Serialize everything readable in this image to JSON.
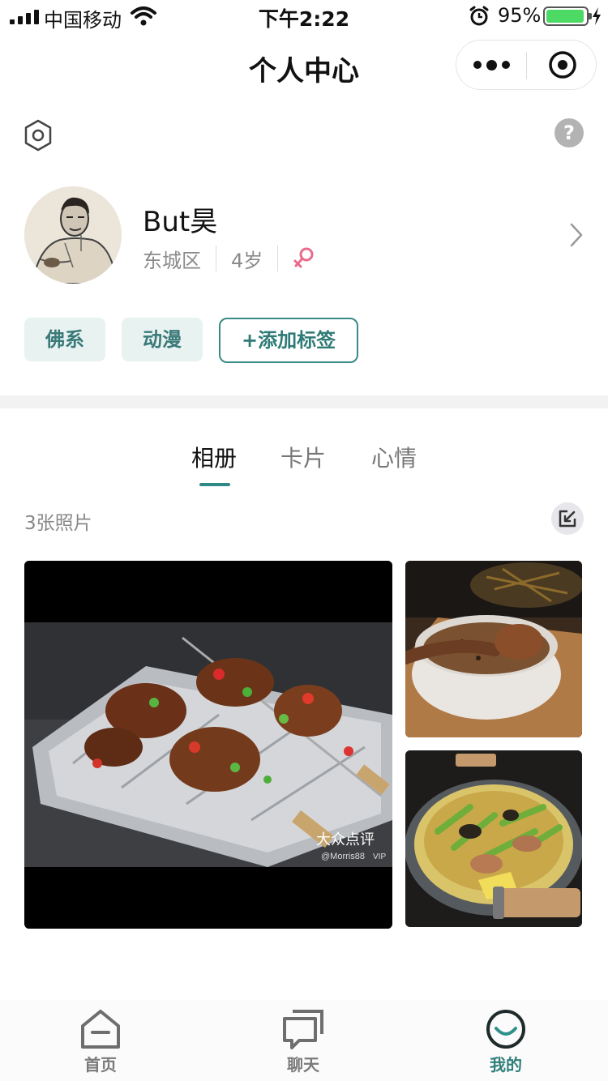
{
  "status_bar": {
    "carrier": "中国移动",
    "time": "下午2:22",
    "battery_percent": "95%",
    "battery_level": 0.95
  },
  "nav": {
    "title": "个人中心"
  },
  "profile": {
    "name": "But昊",
    "district": "东城区",
    "age": "4岁",
    "gender": "female"
  },
  "tags": [
    "佛系",
    "动漫"
  ],
  "add_tag_label": "+添加标签",
  "tabs": [
    {
      "label": "相册",
      "active": true
    },
    {
      "label": "卡片",
      "active": false
    },
    {
      "label": "心情",
      "active": false
    }
  ],
  "album": {
    "count_label": "3张照片",
    "watermark": "大众点评",
    "watermark_user": "@Morris88",
    "watermark_badge": "VIP"
  },
  "tab_bar": [
    {
      "label": "首页",
      "icon": "home-icon",
      "active": false
    },
    {
      "label": "聊天",
      "icon": "chat-icon",
      "active": false
    },
    {
      "label": "我的",
      "icon": "profile-icon",
      "active": true
    }
  ],
  "colors": {
    "accent": "#2f7f7b",
    "tag_bg": "#e8f2f1",
    "battery": "#4cd964"
  }
}
